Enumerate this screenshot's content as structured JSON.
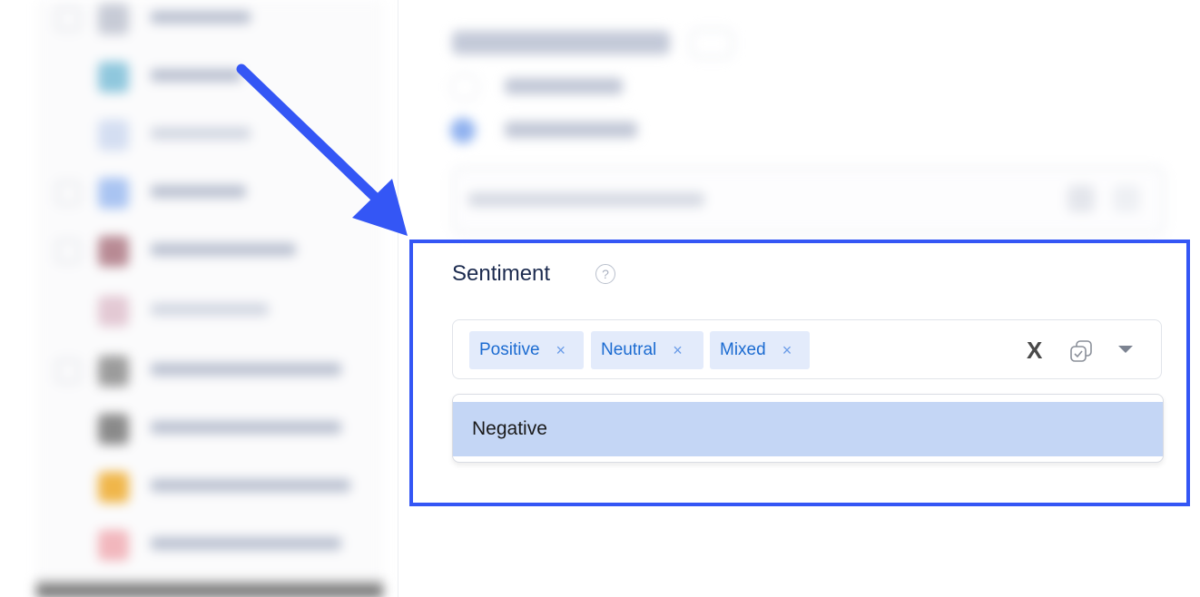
{
  "sentiment": {
    "label": "Sentiment",
    "help_icon": "question-circle-icon",
    "help_glyph": "?",
    "selected": [
      {
        "label": "Positive",
        "remove_icon": "×"
      },
      {
        "label": "Neutral",
        "remove_icon": "×"
      },
      {
        "label": "Mixed",
        "remove_icon": "×"
      }
    ],
    "clear_icon": "X",
    "copy_icon": "copy-check-icon",
    "toggle_icon": "chevron-down-icon",
    "dropdown_options": [
      "Negative"
    ],
    "highlighted_option": "Negative"
  },
  "annotation": {
    "color": "#3456f5",
    "arrow_icon": "pointer-arrow-icon"
  },
  "colors": {
    "chip_bg": "#e3ebfb",
    "chip_text": "#1b6bd1",
    "option_highlight": "#c4d6f5"
  }
}
